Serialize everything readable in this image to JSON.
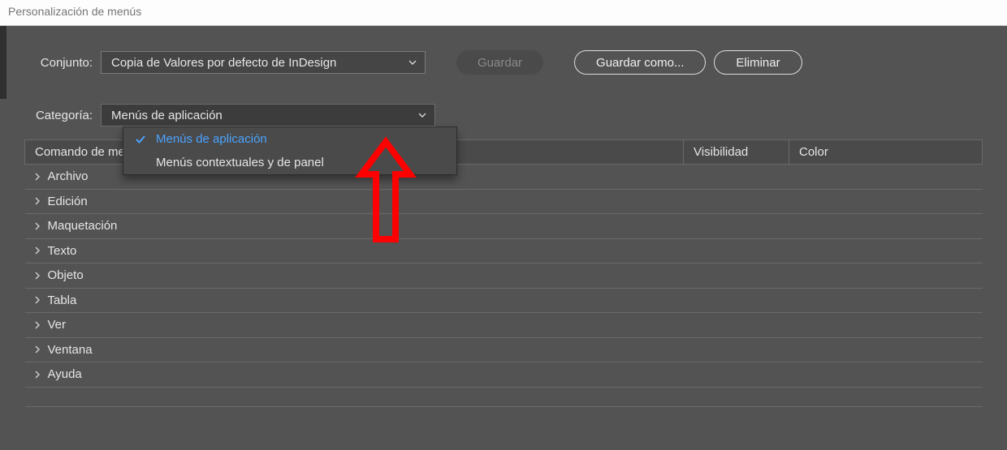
{
  "title": "Personalización de menús",
  "conjunto": {
    "label": "Conjunto:",
    "value": "Copia de Valores por defecto de InDesign"
  },
  "buttons": {
    "save": "Guardar",
    "save_as": "Guardar como...",
    "delete": "Eliminar"
  },
  "categoria": {
    "label": "Categoría:",
    "value": "Menús de aplicación",
    "options": [
      {
        "label": "Menús de aplicación",
        "selected": true
      },
      {
        "label": "Menús contextuales y de panel",
        "selected": false
      }
    ]
  },
  "columns": {
    "command": "Comando de menú de aplicación",
    "visibility": "Visibilidad",
    "color": "Color"
  },
  "rows": [
    "Archivo",
    "Edición",
    "Maquetación",
    "Texto",
    "Objeto",
    "Tabla",
    "Ver",
    "Ventana",
    "Ayuda"
  ]
}
